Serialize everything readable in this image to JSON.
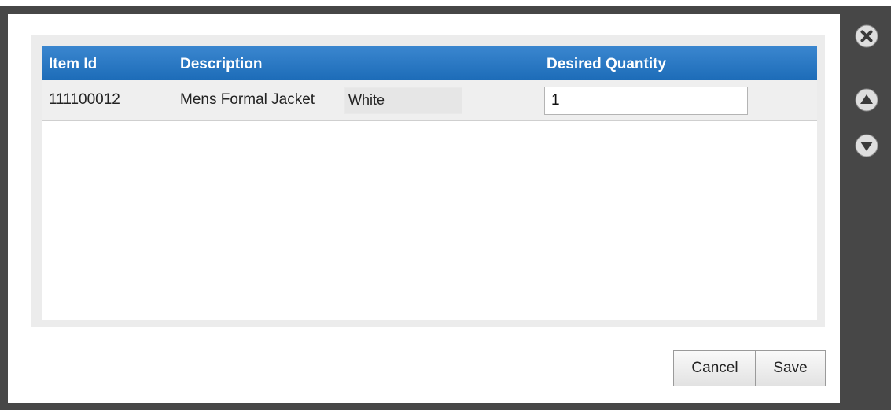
{
  "grid": {
    "columns": {
      "item_id": "Item Id",
      "description": "Description",
      "desired_quantity": "Desired Quantity"
    },
    "rows": [
      {
        "item_id": "111100012",
        "description": "Mens Formal Jacket",
        "color": "White",
        "quantity": "1"
      }
    ]
  },
  "buttons": {
    "cancel": "Cancel",
    "save": "Save"
  },
  "side_icons": [
    "close-icon",
    "arrow-up-icon",
    "arrow-down-icon"
  ],
  "colors": {
    "frame": "#474747",
    "header": "#2a78c4",
    "row": "#efefef"
  }
}
